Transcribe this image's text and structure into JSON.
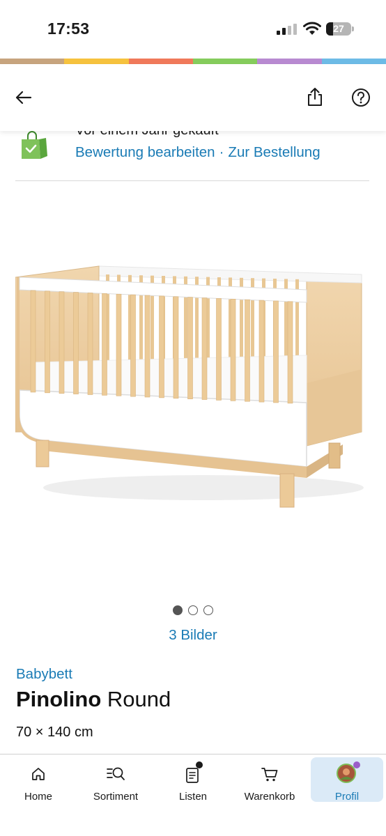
{
  "status_bar": {
    "time": "17:53",
    "battery": "27"
  },
  "stripe_colors": [
    "#c7a47e",
    "#f6c23e",
    "#f0795a",
    "#85cc5c",
    "#b88ad1",
    "#6dbbe6"
  ],
  "header": {
    "back_icon": "arrow-left-icon",
    "share_icon": "share-icon",
    "help_icon": "question-circle-icon"
  },
  "order": {
    "purchased_text": "Vor einem Jahr gekauft",
    "edit_review": "Bewertung bearbeiten",
    "separator": "·",
    "to_order": "Zur Bestellung"
  },
  "gallery": {
    "count_label": "3 Bilder",
    "pages": 3,
    "active_page": 1
  },
  "product": {
    "category": "Babybett",
    "brand": "Pinolino",
    "model": "Round",
    "dimensions": "70 × 140 cm"
  },
  "nav": {
    "items": [
      {
        "label": "Home",
        "icon": "home-icon"
      },
      {
        "label": "Sortiment",
        "icon": "search-list-icon"
      },
      {
        "label": "Listen",
        "icon": "list-icon"
      },
      {
        "label": "Warenkorb",
        "icon": "cart-icon"
      },
      {
        "label": "Profil",
        "icon": "avatar-icon"
      }
    ]
  },
  "colors": {
    "link": "#1a7bb5",
    "active_nav_bg": "#dbeaf7",
    "badge_purple": "#9b5fc8"
  }
}
